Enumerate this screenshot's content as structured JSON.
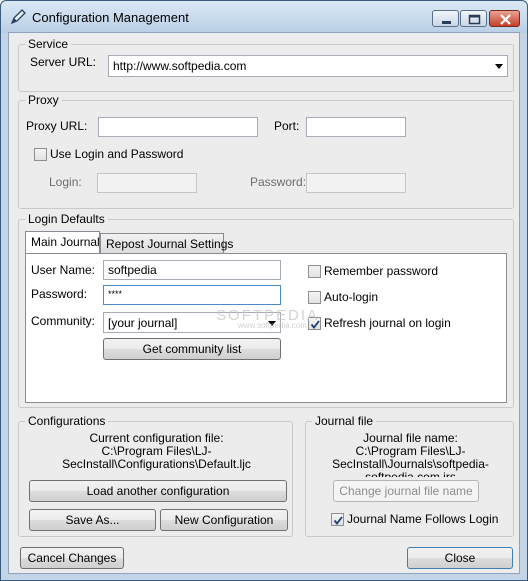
{
  "window": {
    "title": "Configuration Management",
    "icon": "pen-icon"
  },
  "service": {
    "group_title": "Service",
    "server_url_label": "Server URL:",
    "server_url_value": "http://www.softpedia.com"
  },
  "proxy": {
    "group_title": "Proxy",
    "url_label": "Proxy URL:",
    "url_value": "",
    "port_label": "Port:",
    "port_value": "",
    "use_login_label": "Use Login and Password",
    "use_login_checked": false,
    "login_label": "Login:",
    "login_value": "",
    "password_label": "Password:",
    "password_value": ""
  },
  "login_defaults": {
    "group_title": "Login Defaults",
    "tabs": [
      {
        "label": "Main Journal",
        "active": true
      },
      {
        "label": "Repost Journal Settings",
        "active": false
      }
    ],
    "user_name_label": "User Name:",
    "user_name_value": "softpedia",
    "password_label": "Password:",
    "password_value": "****",
    "community_label": "Community:",
    "community_value": "[your journal]",
    "get_community_button": "Get community list",
    "remember_password": {
      "label": "Remember password",
      "checked": false
    },
    "auto_login": {
      "label": "Auto-login",
      "checked": false
    },
    "refresh_journal": {
      "label": "Refresh journal on login",
      "checked": true
    }
  },
  "configurations": {
    "group_title": "Configurations",
    "current_label": "Current configuration file:",
    "current_path_line1": "C:\\Program Files\\LJ-",
    "current_path_line2": "SecInstall\\Configurations\\Default.ljc",
    "load_button": "Load another configuration",
    "save_as_button": "Save As...",
    "new_button": "New Configuration"
  },
  "journal_file": {
    "group_title": "Journal file",
    "name_label": "Journal file name:",
    "path_line1": "C:\\Program Files\\LJ-",
    "path_line2": "SecInstall\\Journals\\softpedia-",
    "path_line3": "softpedia.com.jrs",
    "change_button": "Change journal file name",
    "follows_login": {
      "label": "Journal Name Follows Login",
      "checked": true
    }
  },
  "footer": {
    "cancel_button": "Cancel Changes",
    "close_button": "Close"
  },
  "watermark": {
    "line1": "SOFTPEDIA",
    "line2": "www.softpedia.com"
  }
}
